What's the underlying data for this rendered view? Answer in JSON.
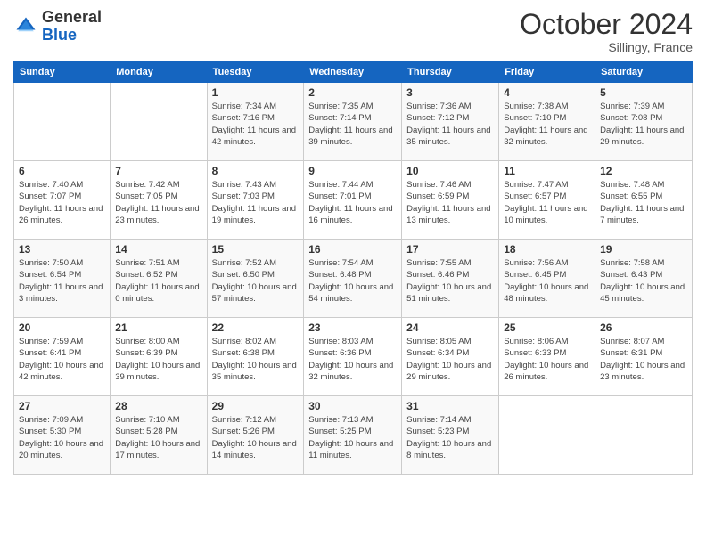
{
  "header": {
    "logo_general": "General",
    "logo_blue": "Blue",
    "month": "October 2024",
    "location": "Sillingy, France"
  },
  "weekdays": [
    "Sunday",
    "Monday",
    "Tuesday",
    "Wednesday",
    "Thursday",
    "Friday",
    "Saturday"
  ],
  "weeks": [
    [
      {
        "day": "",
        "info": ""
      },
      {
        "day": "",
        "info": ""
      },
      {
        "day": "1",
        "info": "Sunrise: 7:34 AM\nSunset: 7:16 PM\nDaylight: 11 hours and 42 minutes."
      },
      {
        "day": "2",
        "info": "Sunrise: 7:35 AM\nSunset: 7:14 PM\nDaylight: 11 hours and 39 minutes."
      },
      {
        "day": "3",
        "info": "Sunrise: 7:36 AM\nSunset: 7:12 PM\nDaylight: 11 hours and 35 minutes."
      },
      {
        "day": "4",
        "info": "Sunrise: 7:38 AM\nSunset: 7:10 PM\nDaylight: 11 hours and 32 minutes."
      },
      {
        "day": "5",
        "info": "Sunrise: 7:39 AM\nSunset: 7:08 PM\nDaylight: 11 hours and 29 minutes."
      }
    ],
    [
      {
        "day": "6",
        "info": "Sunrise: 7:40 AM\nSunset: 7:07 PM\nDaylight: 11 hours and 26 minutes."
      },
      {
        "day": "7",
        "info": "Sunrise: 7:42 AM\nSunset: 7:05 PM\nDaylight: 11 hours and 23 minutes."
      },
      {
        "day": "8",
        "info": "Sunrise: 7:43 AM\nSunset: 7:03 PM\nDaylight: 11 hours and 19 minutes."
      },
      {
        "day": "9",
        "info": "Sunrise: 7:44 AM\nSunset: 7:01 PM\nDaylight: 11 hours and 16 minutes."
      },
      {
        "day": "10",
        "info": "Sunrise: 7:46 AM\nSunset: 6:59 PM\nDaylight: 11 hours and 13 minutes."
      },
      {
        "day": "11",
        "info": "Sunrise: 7:47 AM\nSunset: 6:57 PM\nDaylight: 11 hours and 10 minutes."
      },
      {
        "day": "12",
        "info": "Sunrise: 7:48 AM\nSunset: 6:55 PM\nDaylight: 11 hours and 7 minutes."
      }
    ],
    [
      {
        "day": "13",
        "info": "Sunrise: 7:50 AM\nSunset: 6:54 PM\nDaylight: 11 hours and 3 minutes."
      },
      {
        "day": "14",
        "info": "Sunrise: 7:51 AM\nSunset: 6:52 PM\nDaylight: 11 hours and 0 minutes."
      },
      {
        "day": "15",
        "info": "Sunrise: 7:52 AM\nSunset: 6:50 PM\nDaylight: 10 hours and 57 minutes."
      },
      {
        "day": "16",
        "info": "Sunrise: 7:54 AM\nSunset: 6:48 PM\nDaylight: 10 hours and 54 minutes."
      },
      {
        "day": "17",
        "info": "Sunrise: 7:55 AM\nSunset: 6:46 PM\nDaylight: 10 hours and 51 minutes."
      },
      {
        "day": "18",
        "info": "Sunrise: 7:56 AM\nSunset: 6:45 PM\nDaylight: 10 hours and 48 minutes."
      },
      {
        "day": "19",
        "info": "Sunrise: 7:58 AM\nSunset: 6:43 PM\nDaylight: 10 hours and 45 minutes."
      }
    ],
    [
      {
        "day": "20",
        "info": "Sunrise: 7:59 AM\nSunset: 6:41 PM\nDaylight: 10 hours and 42 minutes."
      },
      {
        "day": "21",
        "info": "Sunrise: 8:00 AM\nSunset: 6:39 PM\nDaylight: 10 hours and 39 minutes."
      },
      {
        "day": "22",
        "info": "Sunrise: 8:02 AM\nSunset: 6:38 PM\nDaylight: 10 hours and 35 minutes."
      },
      {
        "day": "23",
        "info": "Sunrise: 8:03 AM\nSunset: 6:36 PM\nDaylight: 10 hours and 32 minutes."
      },
      {
        "day": "24",
        "info": "Sunrise: 8:05 AM\nSunset: 6:34 PM\nDaylight: 10 hours and 29 minutes."
      },
      {
        "day": "25",
        "info": "Sunrise: 8:06 AM\nSunset: 6:33 PM\nDaylight: 10 hours and 26 minutes."
      },
      {
        "day": "26",
        "info": "Sunrise: 8:07 AM\nSunset: 6:31 PM\nDaylight: 10 hours and 23 minutes."
      }
    ],
    [
      {
        "day": "27",
        "info": "Sunrise: 7:09 AM\nSunset: 5:30 PM\nDaylight: 10 hours and 20 minutes."
      },
      {
        "day": "28",
        "info": "Sunrise: 7:10 AM\nSunset: 5:28 PM\nDaylight: 10 hours and 17 minutes."
      },
      {
        "day": "29",
        "info": "Sunrise: 7:12 AM\nSunset: 5:26 PM\nDaylight: 10 hours and 14 minutes."
      },
      {
        "day": "30",
        "info": "Sunrise: 7:13 AM\nSunset: 5:25 PM\nDaylight: 10 hours and 11 minutes."
      },
      {
        "day": "31",
        "info": "Sunrise: 7:14 AM\nSunset: 5:23 PM\nDaylight: 10 hours and 8 minutes."
      },
      {
        "day": "",
        "info": ""
      },
      {
        "day": "",
        "info": ""
      }
    ]
  ]
}
